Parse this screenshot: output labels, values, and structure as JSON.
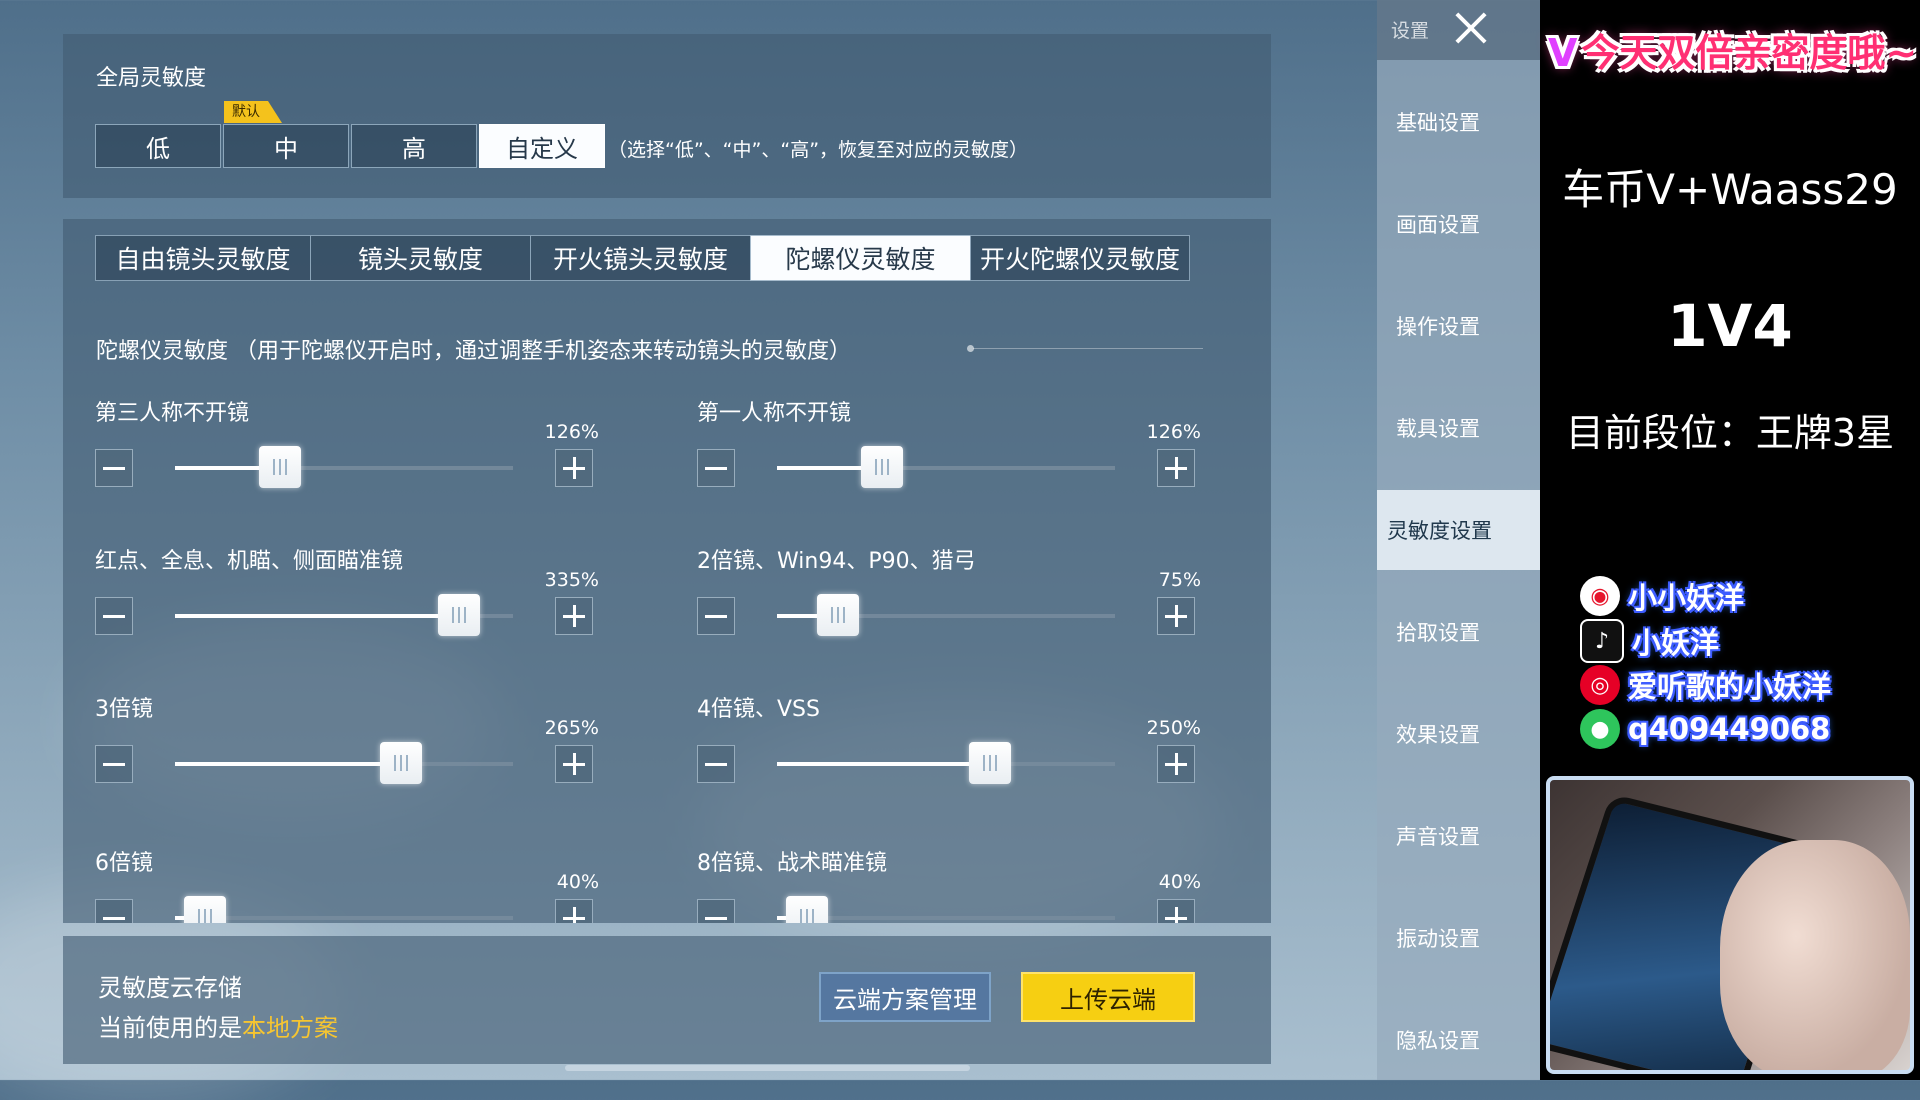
{
  "global": {
    "title": "全局灵敏度",
    "default_tag": "默认",
    "presets": [
      "低",
      "中",
      "高",
      "自定义"
    ],
    "active_preset_index": 3,
    "hint": "（选择“低”、“中”、“高”，恢复至对应的灵敏度）"
  },
  "tabs": [
    "自由镜头灵敏度",
    "镜头灵敏度",
    "开火镜头灵敏度",
    "陀螺仪灵敏度",
    "开火陀螺仪灵敏度"
  ],
  "active_tab_index": 3,
  "description": "陀螺仪灵敏度 （用于陀螺仪开启时，通过调整手机姿态来转动镜头的灵敏度）",
  "sliders": [
    {
      "label": "第三人称不开镜",
      "value": "126%",
      "level": 0.31
    },
    {
      "label": "第一人称不开镜",
      "value": "126%",
      "level": 0.31
    },
    {
      "label": "红点、全息、机瞄、侧面瞄准镜",
      "value": "335%",
      "level": 0.84
    },
    {
      "label": "2倍镜、Win94、P90、猎弓",
      "value": "75%",
      "level": 0.18
    },
    {
      "label": "3倍镜",
      "value": "265%",
      "level": 0.67
    },
    {
      "label": "4倍镜、VSS",
      "value": "250%",
      "level": 0.63
    },
    {
      "label": "6倍镜",
      "value": "40%",
      "level": 0.09
    },
    {
      "label": "8倍镜、战术瞄准镜",
      "value": "40%",
      "level": 0.09
    }
  ],
  "cloud": {
    "title": "灵敏度云存储",
    "status_prefix": "当前使用的是",
    "status_value": "本地方案",
    "manage_label": "云端方案管理",
    "upload_label": "上传云端"
  },
  "sidebar": {
    "title": "设置",
    "items": [
      "基础设置",
      "画面设置",
      "操作设置",
      "载具设置",
      "灵敏度设置",
      "拾取设置",
      "效果设置",
      "声音设置",
      "振动设置",
      "隐私设置"
    ],
    "active_index": 4
  },
  "stream": {
    "banner_v": "V",
    "banner_text": "今天双倍亲密度哦~",
    "wechat_line": "车币V+Waass29",
    "mode": "1V4",
    "rank": "目前段位：王牌3星",
    "socials": [
      {
        "icon": "weibo-icon",
        "text": "小小妖洋"
      },
      {
        "icon": "douyin-icon",
        "text": "小妖洋"
      },
      {
        "icon": "netease-music-icon",
        "text": "爱听歌的小妖洋"
      },
      {
        "icon": "wechat-icon",
        "text": "q409449068"
      }
    ]
  }
}
